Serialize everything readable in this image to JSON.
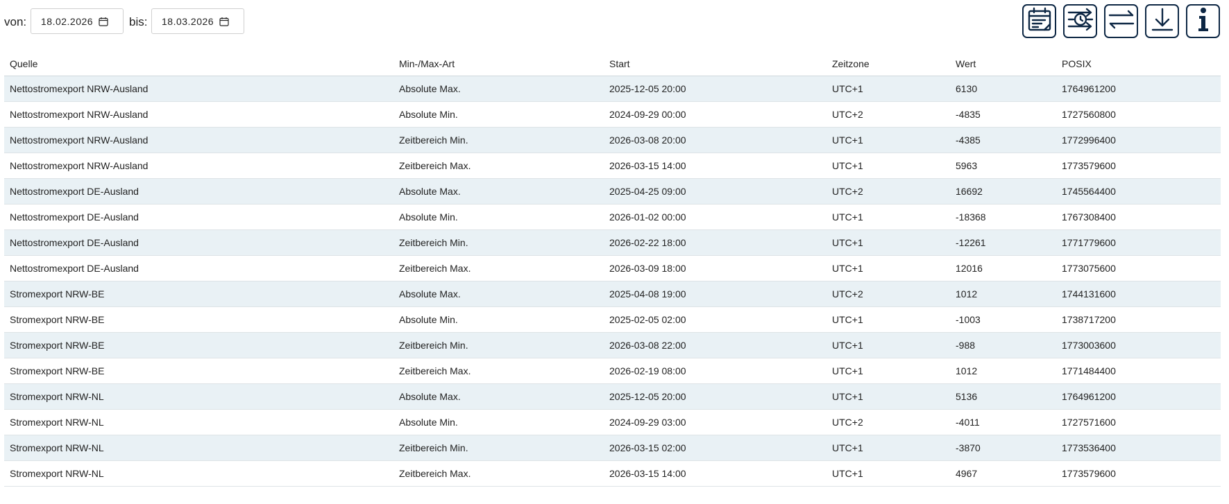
{
  "filter": {
    "from_label": "von:",
    "from_value": "18.02.2026",
    "to_label": "bis:",
    "to_value": "18.03.2026"
  },
  "toolbar_icons": [
    "calendar-edit-icon",
    "timezone-switch-icon",
    "swap-arrows-icon",
    "download-icon",
    "info-icon"
  ],
  "accent_color": "#0d2744",
  "row_stripe_color": "#e9f1f5",
  "table": {
    "headers": [
      "Quelle",
      "Min-/Max-Art",
      "Start",
      "Zeitzone",
      "Wert",
      "POSIX"
    ],
    "rows": [
      [
        "Nettostromexport NRW-Ausland",
        "Absolute Max.",
        "2025-12-05 20:00",
        "UTC+1",
        "6130",
        "1764961200"
      ],
      [
        "Nettostromexport NRW-Ausland",
        "Absolute Min.",
        "2024-09-29 00:00",
        "UTC+2",
        "-4835",
        "1727560800"
      ],
      [
        "Nettostromexport NRW-Ausland",
        "Zeitbereich Min.",
        "2026-03-08 20:00",
        "UTC+1",
        "-4385",
        "1772996400"
      ],
      [
        "Nettostromexport NRW-Ausland",
        "Zeitbereich Max.",
        "2026-03-15 14:00",
        "UTC+1",
        "5963",
        "1773579600"
      ],
      [
        "Nettostromexport DE-Ausland",
        "Absolute Max.",
        "2025-04-25 09:00",
        "UTC+2",
        "16692",
        "1745564400"
      ],
      [
        "Nettostromexport DE-Ausland",
        "Absolute Min.",
        "2026-01-02 00:00",
        "UTC+1",
        "-18368",
        "1767308400"
      ],
      [
        "Nettostromexport DE-Ausland",
        "Zeitbereich Min.",
        "2026-02-22 18:00",
        "UTC+1",
        "-12261",
        "1771779600"
      ],
      [
        "Nettostromexport DE-Ausland",
        "Zeitbereich Max.",
        "2026-03-09 18:00",
        "UTC+1",
        "12016",
        "1773075600"
      ],
      [
        "Stromexport NRW-BE",
        "Absolute Max.",
        "2025-04-08 19:00",
        "UTC+2",
        "1012",
        "1744131600"
      ],
      [
        "Stromexport NRW-BE",
        "Absolute Min.",
        "2025-02-05 02:00",
        "UTC+1",
        "-1003",
        "1738717200"
      ],
      [
        "Stromexport NRW-BE",
        "Zeitbereich Min.",
        "2026-03-08 22:00",
        "UTC+1",
        "-988",
        "1773003600"
      ],
      [
        "Stromexport NRW-BE",
        "Zeitbereich Max.",
        "2026-02-19 08:00",
        "UTC+1",
        "1012",
        "1771484400"
      ],
      [
        "Stromexport NRW-NL",
        "Absolute Max.",
        "2025-12-05 20:00",
        "UTC+1",
        "5136",
        "1764961200"
      ],
      [
        "Stromexport NRW-NL",
        "Absolute Min.",
        "2024-09-29 03:00",
        "UTC+2",
        "-4011",
        "1727571600"
      ],
      [
        "Stromexport NRW-NL",
        "Zeitbereich Min.",
        "2026-03-15 02:00",
        "UTC+1",
        "-3870",
        "1773536400"
      ],
      [
        "Stromexport NRW-NL",
        "Zeitbereich Max.",
        "2026-03-15 14:00",
        "UTC+1",
        "4967",
        "1773579600"
      ]
    ]
  }
}
